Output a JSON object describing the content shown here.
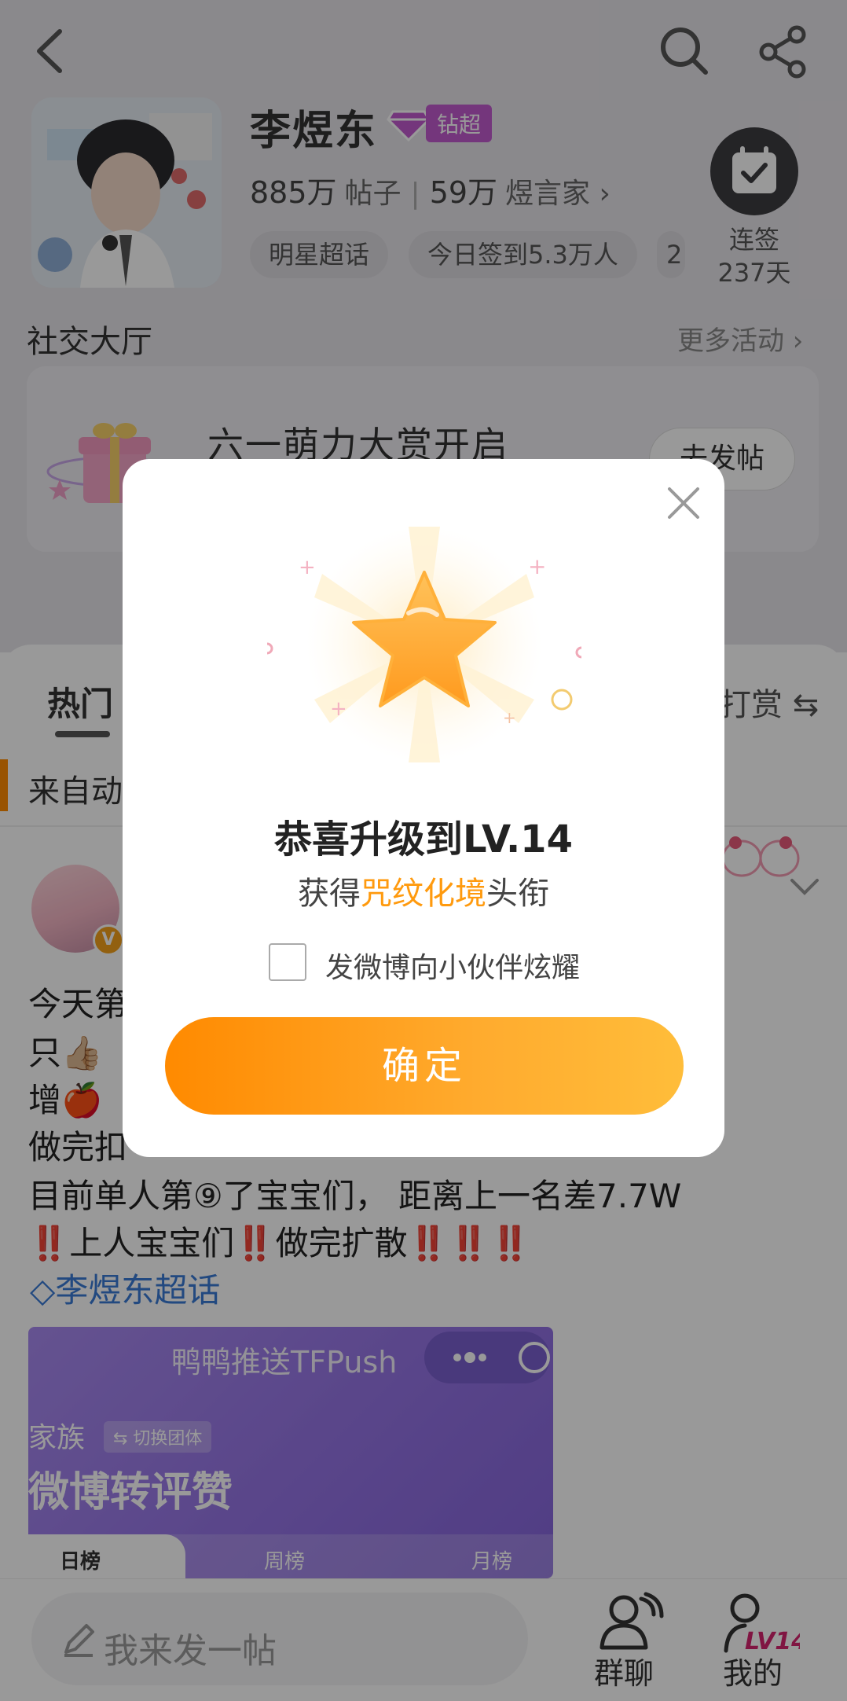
{
  "header": {
    "name": "李煜东",
    "badge": "钻超",
    "stats": {
      "posts_value": "885万",
      "posts_label": "帖子",
      "fans_value": "59万",
      "fans_label": "煜言家 ›"
    },
    "chips": [
      "明星超话",
      "今日签到5.3万人",
      "2"
    ],
    "checkin_label_1": "连签",
    "checkin_label_2": "237天"
  },
  "social": {
    "title": "社交大厅",
    "more": "更多活动 ›",
    "banner_title": "六一萌力大赏开启",
    "banner_button": "去发帖"
  },
  "tabs": {
    "hot": "热门",
    "right": "打赏"
  },
  "feed": {
    "from_text": "来自动",
    "post_lines": [
      "今天第",
      "只👍🏼",
      "增🍎",
      "做完扣",
      "目前单人第⑨了宝宝们， 距离上一名差7.7W",
      "‼️上人宝宝们‼️做完扩散‼️‼️‼️"
    ],
    "topic": "李煜东超话",
    "card": {
      "title": "鸭鸭推送TFPush",
      "sub": "家族",
      "switch": "⇆ 切换团体",
      "big": "微博转评赞",
      "tab_day": "日榜",
      "tab_week": "周榜",
      "tab_month": "月榜"
    }
  },
  "bottom": {
    "compose_placeholder": "我来发一帖",
    "group_label": "群聊",
    "mine_label": "我的",
    "level_badge": "LV14"
  },
  "dialog": {
    "title": "恭喜升级到LV.14",
    "sub_prefix": "获得",
    "sub_highlight": "咒纹化境",
    "sub_suffix": "头衔",
    "checkbox_label": "发微博向小伙伴炫耀",
    "confirm": "确定"
  },
  "colors": {
    "accent_orange": "#ff9a0e",
    "badge_purple": "#c25bcf",
    "topic_blue": "#3a7bd5"
  }
}
